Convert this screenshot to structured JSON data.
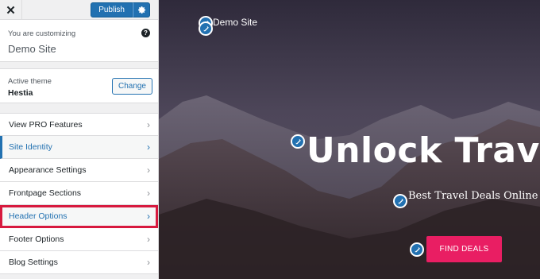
{
  "toolbar": {
    "close_label": "✕",
    "publish_label": "Publish"
  },
  "customizing": {
    "label": "You are customizing",
    "site_name": "Demo Site",
    "help_label": "?"
  },
  "theme": {
    "label": "Active theme",
    "name": "Hestia",
    "change_label": "Change"
  },
  "menu": {
    "items": [
      {
        "label": "View PRO Features"
      },
      {
        "label": "Site Identity"
      },
      {
        "label": "Appearance Settings"
      },
      {
        "label": "Frontpage Sections"
      },
      {
        "label": "Header Options"
      },
      {
        "label": "Footer Options"
      },
      {
        "label": "Blog Settings"
      }
    ],
    "chevron": "›"
  },
  "preview": {
    "site_title": "Demo Site",
    "hero_title": "Unlock Travel D",
    "hero_subtitle": "Best Travel Deals Online",
    "cta_label": "FIND DEALS"
  },
  "colors": {
    "accent": "#2271b1",
    "highlight": "#d7193e",
    "cta": "#e91e63"
  }
}
